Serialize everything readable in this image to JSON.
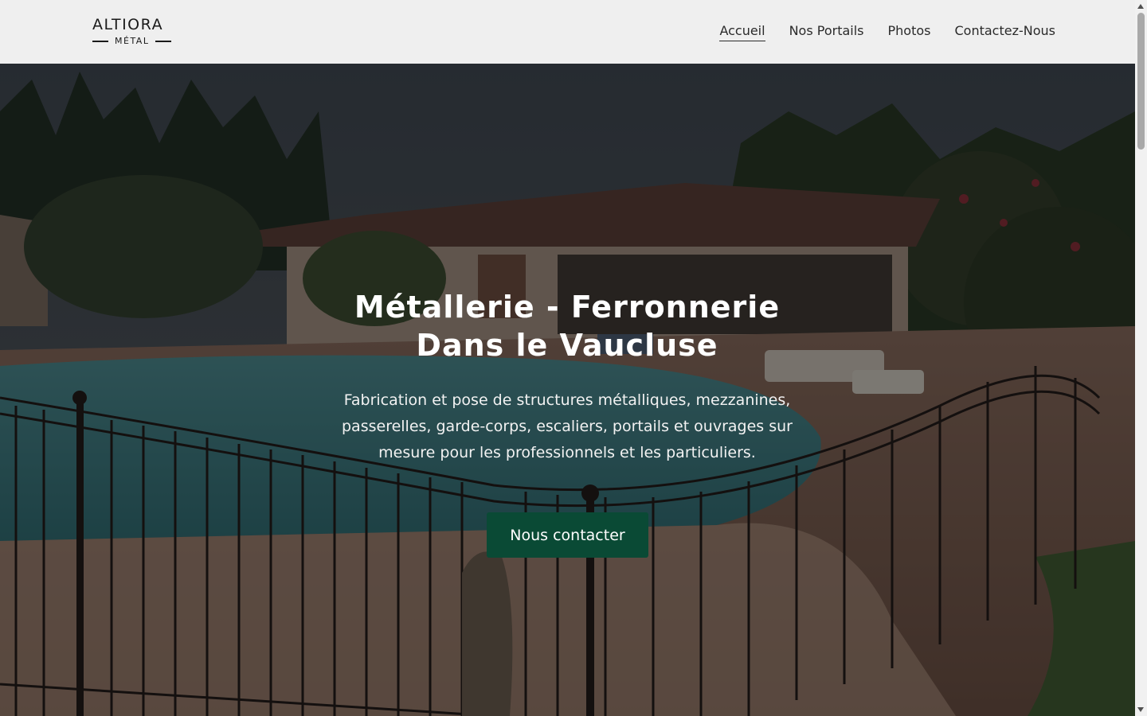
{
  "header": {
    "logo": {
      "main": "ALTIORA",
      "sub": "MÉTAL"
    },
    "nav": [
      {
        "label": "Accueil",
        "active": true
      },
      {
        "label": "Nos Portails",
        "active": false
      },
      {
        "label": "Photos",
        "active": false
      },
      {
        "label": "Contactez-Nous",
        "active": false
      }
    ]
  },
  "hero": {
    "title_line1": "Métallerie - Ferronnerie",
    "title_line2": "Dans le Vaucluse",
    "description": "Fabrication et pose de structures métalliques, mezzanines, passerelles, garde-corps, escaliers, portails et ouvrages sur mesure pour les professionnels et les particuliers.",
    "cta_label": "Nous contacter",
    "background": "pool-terrace-with-iron-fence-photo"
  },
  "colors": {
    "header_bg": "#efefef",
    "cta_bg": "#0a4a35",
    "text_dark": "#1a1a1a"
  }
}
